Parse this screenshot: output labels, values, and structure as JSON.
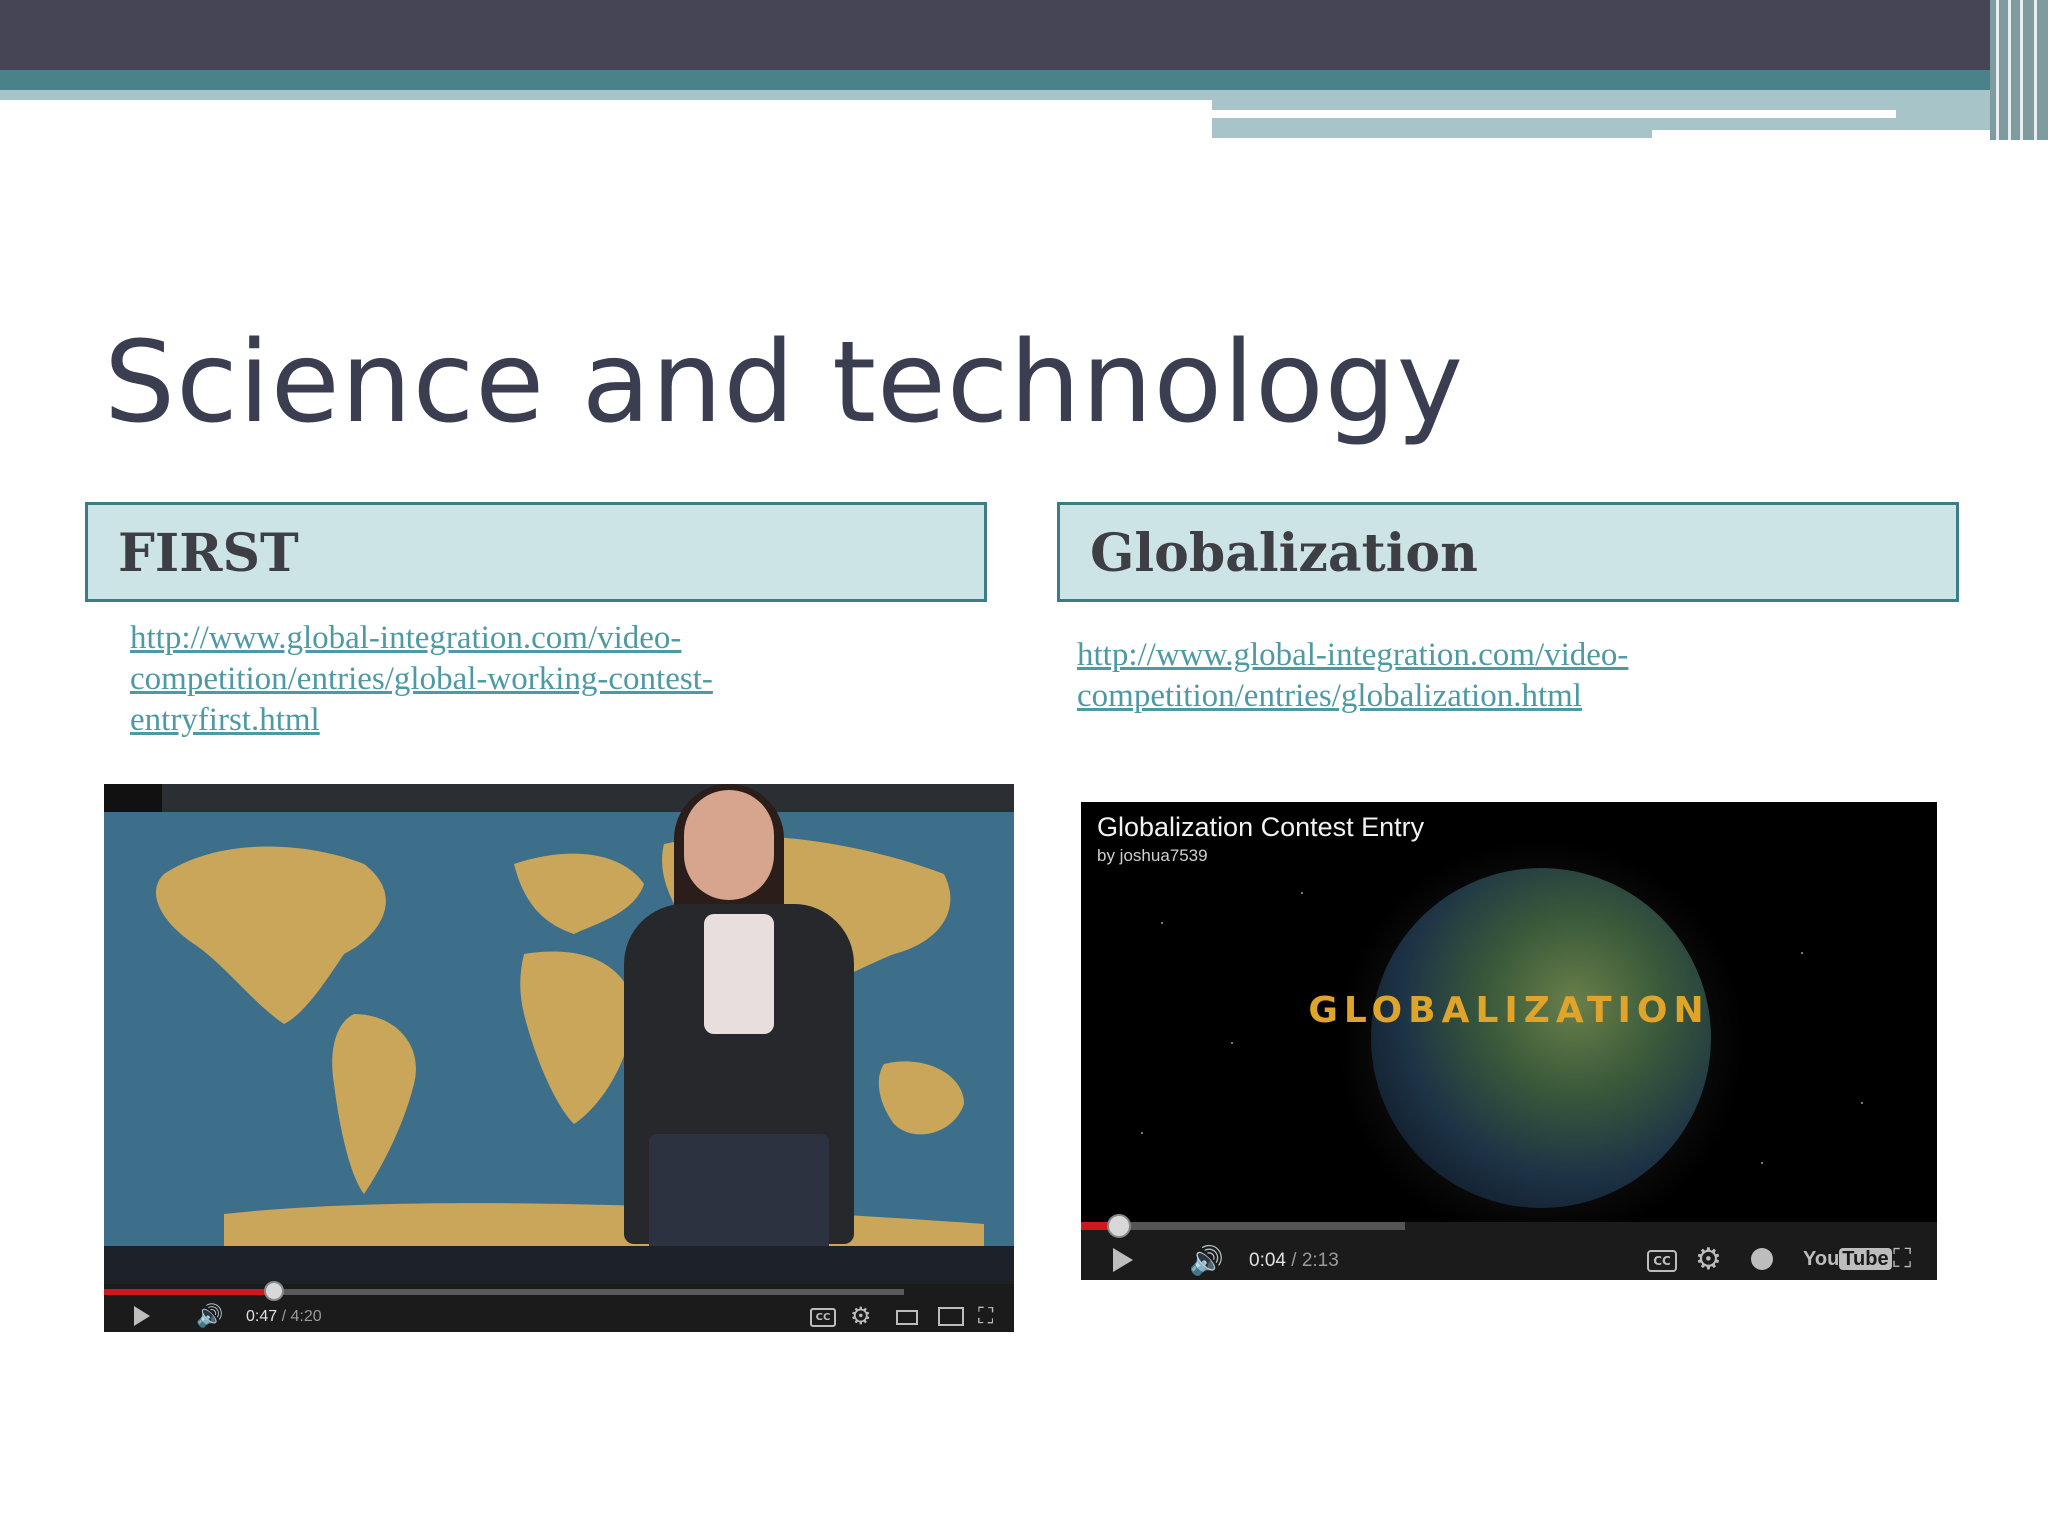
{
  "slide": {
    "title": "Science and technology"
  },
  "left_panel": {
    "header": "FIRST",
    "link": "http://www.global-integration.com/video-competition/entries/global-working-contest-entryfirst.html",
    "video": {
      "time_current": "0:47",
      "time_sep": " / ",
      "time_total": "4:20",
      "progress": 0.19
    }
  },
  "right_panel": {
    "header": "Globalization",
    "link": "http://www.global-integration.com/video-competition/entries/globalization.html",
    "video": {
      "title": "Globalization Contest Entry",
      "author": "by joshua7539",
      "overlay_word": "GLOBALIZATION",
      "time_current": "0:04",
      "time_sep": " / ",
      "time_total": "2:13",
      "progress": 0.03,
      "cc_label": "CC",
      "logo_you": "You",
      "logo_tube": "Tube"
    }
  },
  "colors": {
    "title": "#3b3d51",
    "header_fill": "#cde4e6",
    "header_border": "#3a7d84",
    "link": "#4d9aa4",
    "progress_red": "#cc181e",
    "band_dark": "#454556",
    "band_teal": "#4b8189"
  },
  "icons": [
    "play-icon",
    "volume-icon",
    "cc-icon",
    "gear-icon",
    "clock-icon",
    "fullscreen-icon"
  ]
}
